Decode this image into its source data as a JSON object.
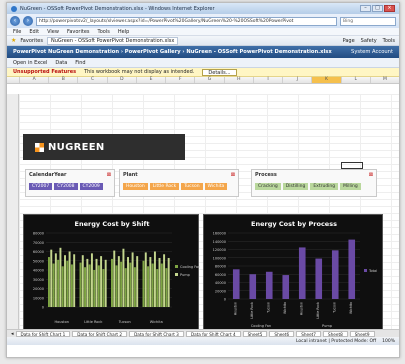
{
  "browser": {
    "title": "NuGreen - OSSoft PowerPivot Demonstration.xlsx - Windows Internet Explorer",
    "address": "http://powerpivotsv2/_layouts/xlviewer.aspx?id=/PowerPivot%20Gallery/NuGreen%20-%20OSSoft%20PowerPivot",
    "search_placeholder": "Bing",
    "menu": [
      "File",
      "Edit",
      "View",
      "Favorites",
      "Tools",
      "Help"
    ],
    "favorites_label": "Favorites",
    "tab_label": "NuGreen - OSSoft PowerPivot Demonstration.xlsx",
    "tools": [
      "Page",
      "Safety",
      "Tools"
    ]
  },
  "ribbon": {
    "breadcrumb": "PowerPivot NuGreen Demonstration  ›  PowerPivot Gallery  ›  NuGreen - OSSoft PowerPivot Demonstration.xlsx",
    "user": "System Account"
  },
  "toolbar": {
    "open_label": "Open in Excel",
    "data_label": "Data",
    "find_label": "Find"
  },
  "infobar": {
    "label": "Unsupported Features",
    "message": "This workbook may not display as intended.",
    "button": "Details..."
  },
  "columns": [
    "A",
    "B",
    "C",
    "D",
    "E",
    "F",
    "G",
    "H",
    "I",
    "J",
    "K",
    "L",
    "M"
  ],
  "logo_text": "NUGREEN",
  "slicers": {
    "calendar": {
      "title": "CalendarYear",
      "items": [
        "CY2007",
        "CY2008",
        "CY2009"
      ]
    },
    "plant": {
      "title": "Plant",
      "items": [
        "Houston",
        "Little Rock",
        "Tucson",
        "Wichita"
      ]
    },
    "process": {
      "title": "Process",
      "items": [
        "Cracking",
        "Distilling",
        "Extruding",
        "Milling"
      ]
    }
  },
  "charts": {
    "shift": {
      "title": "Energy Cost by Shift",
      "yticks": [
        "80000",
        "70000",
        "60000",
        "50000",
        "40000",
        "30000",
        "20000",
        "10000",
        "0"
      ],
      "legend": [
        "Cooling Fan",
        "Pump"
      ],
      "colors": [
        "#7fa644",
        "#c4d68e"
      ],
      "groups": [
        "Houston",
        "Little Rock",
        "Tucson",
        "Wichita"
      ],
      "values": [
        [
          54000,
          62000,
          47000,
          58000,
          51000,
          64000,
          44000,
          56000,
          50000,
          60000,
          46000,
          57000
        ],
        [
          48000,
          56000,
          43000,
          52000,
          46000,
          58000,
          40000,
          52000,
          45000,
          55000,
          41000,
          51000
        ],
        [
          52000,
          61000,
          45000,
          55000,
          49000,
          63000,
          42000,
          54000,
          48000,
          59000,
          43000,
          55000
        ],
        [
          50000,
          59000,
          44000,
          54000,
          47000,
          60000,
          41000,
          53000,
          47000,
          57000,
          42000,
          53000
        ]
      ]
    },
    "process": {
      "title": "Energy Cost by Process",
      "yticks": [
        "160000",
        "140000",
        "120000",
        "100000",
        "80000",
        "60000",
        "40000",
        "20000",
        "0"
      ],
      "legend": [
        "Total"
      ],
      "color": "#6a4aa5",
      "groups": [
        "Cooling Fan",
        "Pump"
      ],
      "categories": [
        "Houston",
        "Little Rock",
        "Tucson",
        "Wichita",
        "Houston",
        "Little Rock",
        "Tucson",
        "Wichita"
      ],
      "values": [
        72000,
        60000,
        66000,
        58000,
        125000,
        98000,
        118000,
        144000
      ]
    }
  },
  "sheet_tabs": [
    "Data for Shift Chart 1",
    "Data for Shift Chart 2",
    "Data for Shift Chart 3",
    "Data for Shift Chart 4",
    "Sheet5",
    "Sheet6",
    "Sheet7",
    "Sheet8",
    "Sheet9"
  ],
  "status": {
    "zone": "Local intranet | Protected Mode: Off",
    "zoom": "100%"
  }
}
